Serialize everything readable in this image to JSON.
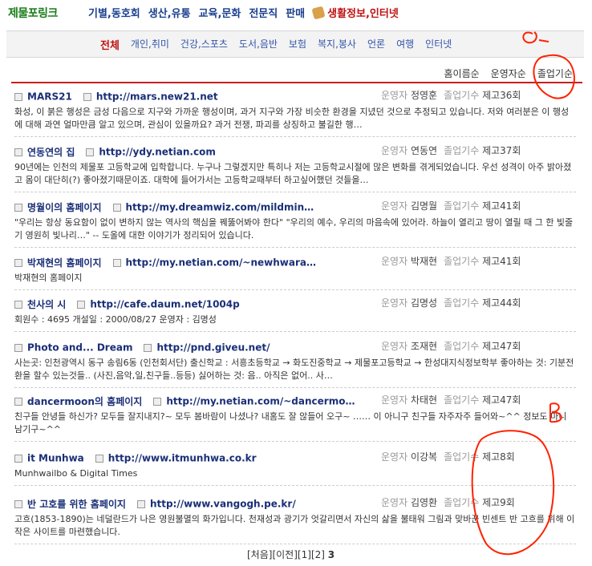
{
  "topnav": {
    "logo": "제물포링크",
    "links": [
      "기별,동호회",
      "생산,유통",
      "교육,문화",
      "전문직",
      "판매"
    ],
    "highlight": "생활정보,인터넷"
  },
  "tabs": [
    "전체",
    "개인,취미",
    "건강,스포츠",
    "도서,음반",
    "보험",
    "복지,봉사",
    "언론",
    "여행",
    "인터넷"
  ],
  "sort": [
    "홈이름순",
    "운영자순",
    "졸업기순"
  ],
  "meta_labels": {
    "operator": "운영자",
    "grad": "졸업기수"
  },
  "entries": [
    {
      "title": "MARS21",
      "url": "http://mars.new21.net",
      "operator": "정영훈",
      "grad": "제고36회",
      "desc": "화성, 이 붉은 행성은 금성 다음으로 지구와 가까운 행성이며, 과거 지구와 가장 비슷한 환경을 지녔던 것으로 추정되고 있습니다. 저와 여러분은 이 행성에 대해 과연 얼마만큼 알고 있으며, 관심이 있을까요? 과거 전쟁, 파괴를 상징하고 불길한 행…"
    },
    {
      "title": "연동연의 집",
      "url": "http://ydy.netian.com",
      "operator": "연동연",
      "grad": "제고37회",
      "desc": "90년에는 인천의 제물포 고등학교에 입학합니다. 누구나 그렇겠지만 특히나 저는 고등학교시절에 많은 변화를 겪게되었습니다. 우선 성격이 아주 밝아졌고 몸이 대단히(?) 좋아졌기때문이죠. 대학에 들어가서는 고등학교때부터 하고싶어했던 것들을…"
    },
    {
      "title": "명월이의 홈페이지",
      "url": "http://my.dreamwiz.com/mildmin…",
      "operator": "김명월",
      "grad": "제고41회",
      "desc": "\"우리는 항상 동요함이 없이 변하지 않는 역사의 핵심을 꿰뚫어봐야 한다\" \"우리의 예수, 우리의 마음속에 있어라. 하늘이 열리고 땅이 열릴 때 그 한 빛줄기 영원히 빛나리…\" -- 도올에 대한 이야기가 정리되어 있습니다."
    },
    {
      "title": "박재현의 홈페이지",
      "url": "http://my.netian.com/~newhwara…",
      "operator": "박재현",
      "grad": "제고41회",
      "desc": "박재현의 홈페이지"
    },
    {
      "title": "천사의 시",
      "url": "http://cafe.daum.net/1004p",
      "operator": "김명성",
      "grad": "제고44회",
      "desc": "회원수 : 4695 개설일 : 2000/08/27 운영자 : 김명성"
    },
    {
      "title": "Photo and... Dream",
      "url": "http://pnd.giveu.net/",
      "operator": "조재현",
      "grad": "제고47회",
      "desc": "사는곳: 인천광역시 동구 송림6동 (인천회서단) 출신학교 : 서흥초등학교 → 화도진중학교 → 제물포고등학교 → 한성대지식정보학부 좋아하는 것: 기분전환을 할수 있는것들.. (사진,음악,일,친구들..등등) 싫어하는 것: 음.. 아직은 없어.. 사…"
    },
    {
      "title": "dancermoon의 홈페이지",
      "url": "http://my.netian.com/~dancermo…",
      "operator": "차태현",
      "grad": "제고47회",
      "desc": "친구들 안녕들 하신가? 모두들 잘지내지?~ 모두 봄바람이 나셨나? 내홈도 잘 않들어 오구~ …… 이 아니구 친구들 자주자주 들어와~^^ 정보도 마니 남기구~^^"
    },
    {
      "title": "it Munhwa",
      "url": "http://www.itmunhwa.co.kr",
      "operator": "이강복",
      "grad": "제고8회",
      "desc": "Munhwailbo & Digital Times"
    },
    {
      "title": "반 고호를 위한 홈페이지",
      "url": "http://www.vangogh.pe.kr/",
      "operator": "김영환",
      "grad": "제고9회",
      "desc": "고흐(1853-1890)는 네덜란드가 나은 영원불멸의 화가입니다. 천재성과 광기가 엇갈리면서 자신의 삶을 불태워 그림과 맞바꾼 빈센트 반 고흐를 위해 이 작은 사이트를 마련했습니다."
    }
  ],
  "pager": {
    "first": "[처음]",
    "prev": "[이전]",
    "p1": "[1]",
    "p2": "[2]",
    "current": "3"
  },
  "annotations": {
    "a_label": "a",
    "b_label": "B",
    "color": "#ff2200"
  }
}
